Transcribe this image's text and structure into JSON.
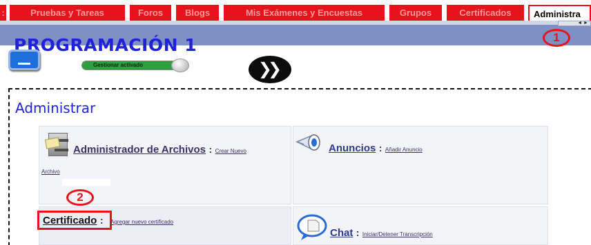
{
  "tabs": [
    {
      "label": ":"
    },
    {
      "label": "Pruebas y Tareas"
    },
    {
      "label": "Foros"
    },
    {
      "label": "Blogs"
    },
    {
      "label": "Mis Exámenes y Encuestas"
    },
    {
      "label": "Grupos"
    },
    {
      "label": "Certificados"
    },
    {
      "label": "Administra"
    }
  ],
  "scroll_arrows": "◄ ►",
  "page": {
    "title": "PROGRAMACIÓN 1"
  },
  "annotations": {
    "one": "1",
    "two": "2"
  },
  "toggle": {
    "label": "Gestionar activado"
  },
  "ff_button": {
    "glyph": "❯❯"
  },
  "admin": {
    "title": "Administrar",
    "cards": {
      "files": {
        "title": "Administrador de Archivos",
        "colon": ":",
        "action": "Crear Nuevo",
        "action2": "Archivo"
      },
      "announcements": {
        "title": "Anuncios",
        "colon": ":",
        "action": "Añadir Anuncio"
      },
      "certificate": {
        "title": "Certificado",
        "colon": ":",
        "action": "Agregar nuevo certificado"
      },
      "chat": {
        "title": "Chat",
        "colon": ":",
        "action": "Iniciar/Detener Transcripción"
      }
    }
  },
  "icons": {
    "monitor": "monitor-icon",
    "cabinet": "file-cabinet-icon",
    "megaphone": "megaphone-icon",
    "chat": "chat-bubble-icon"
  },
  "colors": {
    "tab_red": "#e8121c",
    "band_blue": "#7e90c4",
    "title_blue": "#1f22d8",
    "annotation_red": "#e8121c"
  }
}
